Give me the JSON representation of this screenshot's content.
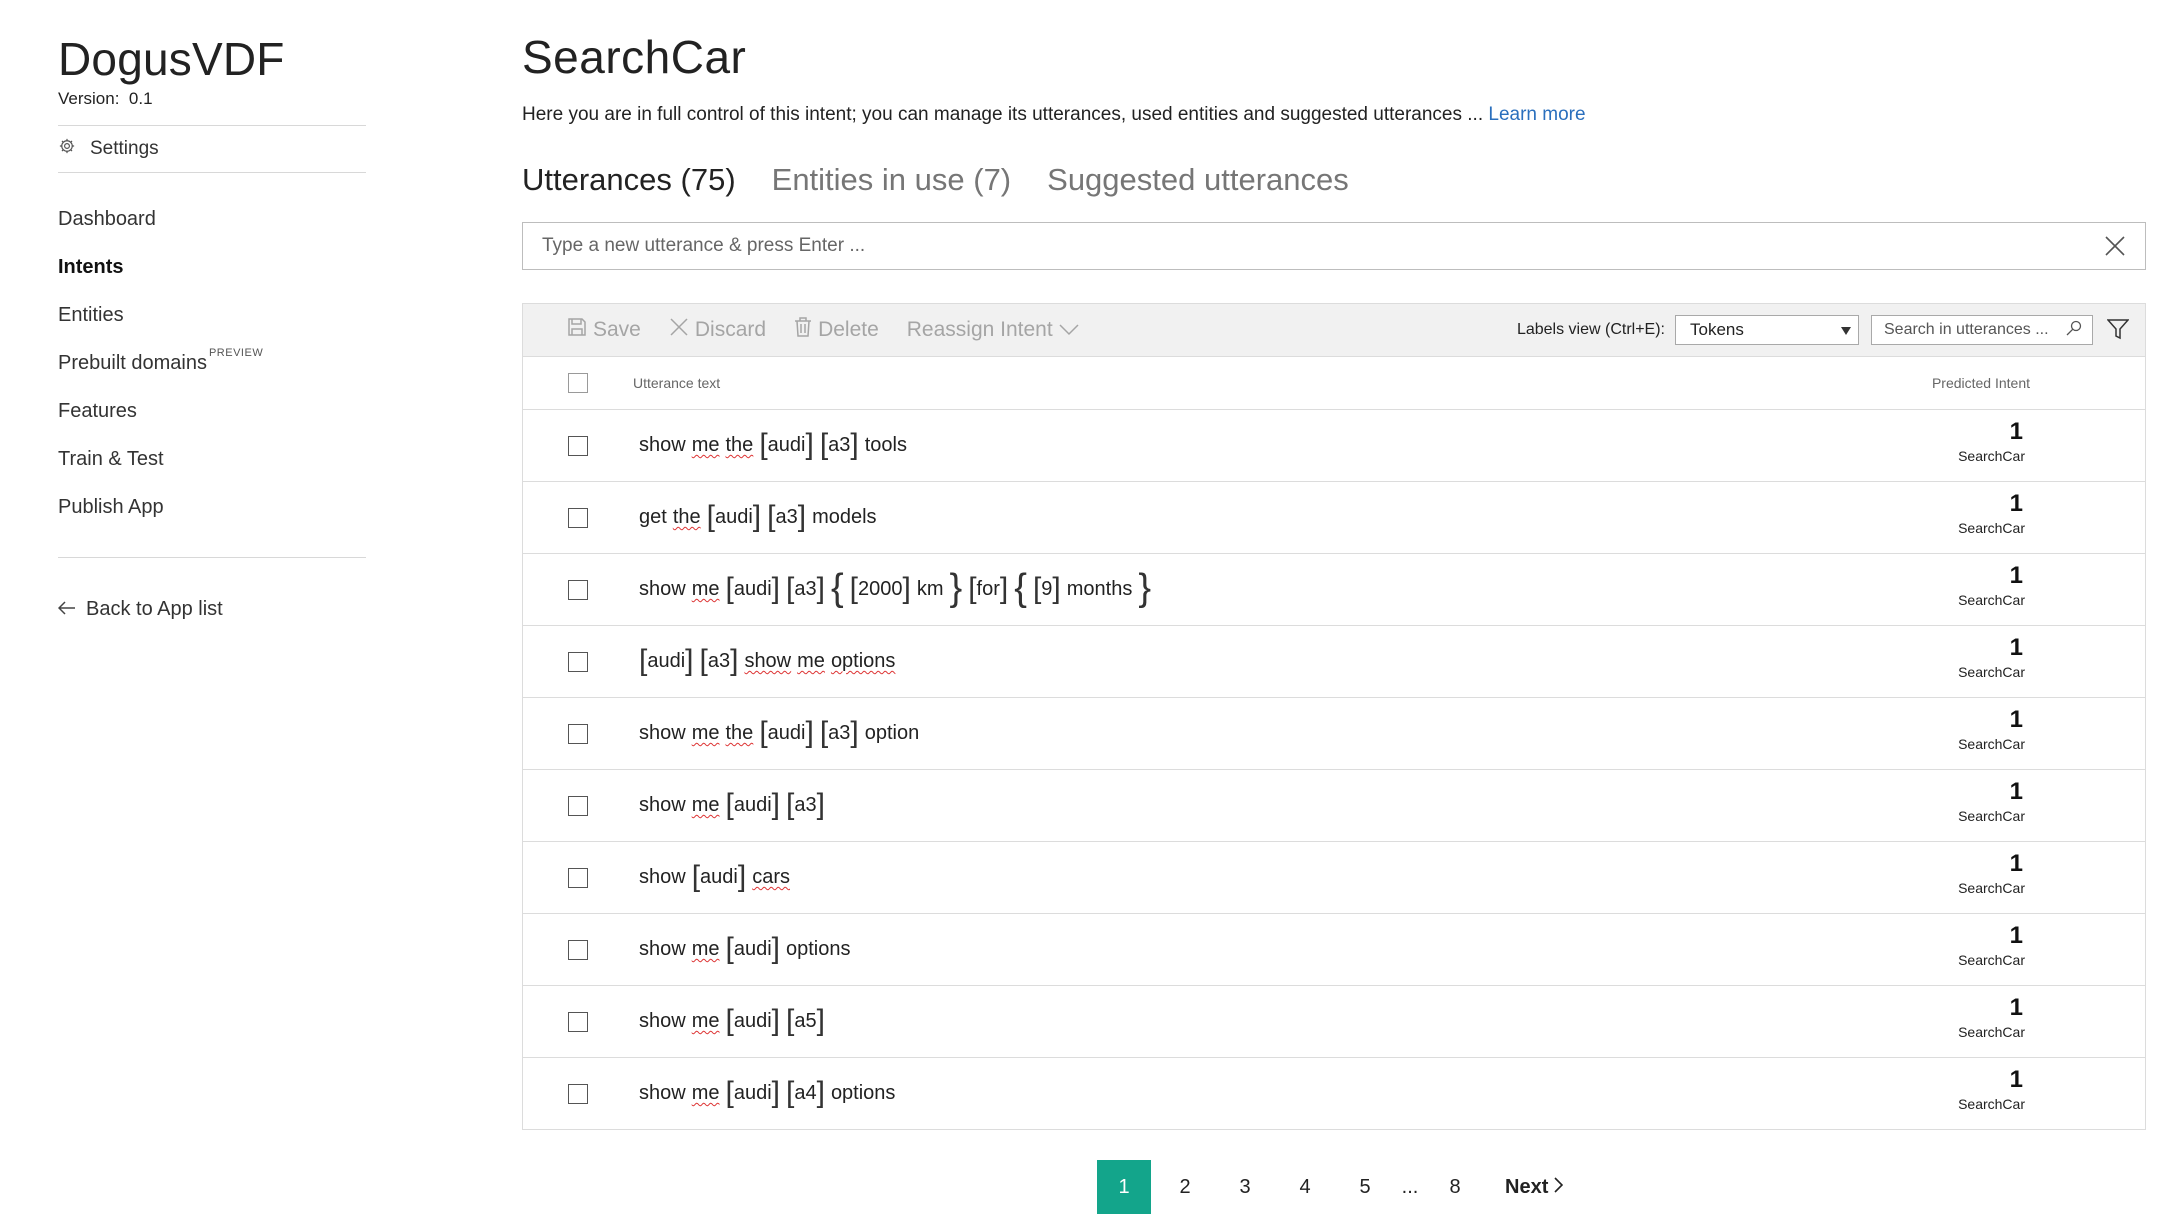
{
  "sidebar": {
    "app_name": "DogusVDF",
    "version_label": "Version:",
    "version_value": "0.1",
    "settings_label": "Settings",
    "nav": [
      {
        "label": "Dashboard",
        "active": false
      },
      {
        "label": "Intents",
        "active": true
      },
      {
        "label": "Entities",
        "active": false
      },
      {
        "label": "Prebuilt domains",
        "active": false,
        "badge": "PREVIEW"
      },
      {
        "label": "Features",
        "active": false
      },
      {
        "label": "Train & Test",
        "active": false
      },
      {
        "label": "Publish App",
        "active": false
      }
    ],
    "back_label": "Back to App list"
  },
  "main": {
    "title": "SearchCar",
    "description": "Here you are in full control of this intent; you can manage its utterances, used entities and suggested utterances ... ",
    "learn_more": "Learn more",
    "tabs": [
      {
        "label": "Utterances (75)",
        "active": true
      },
      {
        "label": "Entities in use (7)",
        "active": false
      },
      {
        "label": "Suggested utterances",
        "active": false
      }
    ],
    "utterance_input_placeholder": "Type a new utterance & press Enter ..."
  },
  "toolbar": {
    "save_label": "Save",
    "discard_label": "Discard",
    "delete_label": "Delete",
    "reassign_label": "Reassign Intent",
    "labels_view_label": "Labels view (Ctrl+E):",
    "labels_view_value": "Tokens",
    "search_placeholder": "Search in utterances ..."
  },
  "table": {
    "col_utterance": "Utterance text",
    "col_predicted": "Predicted Intent",
    "rows": [
      {
        "text": "show me the [audi] [a3] tools",
        "score": "1",
        "intent": "SearchCar"
      },
      {
        "text": "get the [audi] [a3] models",
        "score": "1",
        "intent": "SearchCar"
      },
      {
        "text": "show me [audi] [a3] {[2000] km} [for] {[9] months}",
        "score": "1",
        "intent": "SearchCar"
      },
      {
        "text": "[audi] [a3] show me options",
        "score": "1",
        "intent": "SearchCar"
      },
      {
        "text": "show me the [audi] [a3] option",
        "score": "1",
        "intent": "SearchCar"
      },
      {
        "text": "show me [audi] [a3]",
        "score": "1",
        "intent": "SearchCar"
      },
      {
        "text": "show [audi] cars",
        "score": "1",
        "intent": "SearchCar"
      },
      {
        "text": "show me [audi] options",
        "score": "1",
        "intent": "SearchCar"
      },
      {
        "text": "show me [audi] [a5]",
        "score": "1",
        "intent": "SearchCar"
      },
      {
        "text": "show me [audi] [a4] options",
        "score": "1",
        "intent": "SearchCar"
      }
    ]
  },
  "pagination": {
    "current": "1",
    "pages": [
      "2",
      "3",
      "4",
      "5"
    ],
    "ellipsis": "...",
    "last": "8",
    "next_label": "Next"
  },
  "colors": {
    "accent": "#13a58b",
    "link": "#2a6fbd"
  },
  "icons": {
    "settings": "gear-icon",
    "back": "arrow-left-icon",
    "close": "close-icon",
    "save": "save-icon",
    "discard": "discard-icon",
    "delete": "trash-icon",
    "reassign": "chevron-down-icon",
    "search": "search-icon",
    "filter": "filter-icon",
    "next": "chevron-right-icon"
  }
}
